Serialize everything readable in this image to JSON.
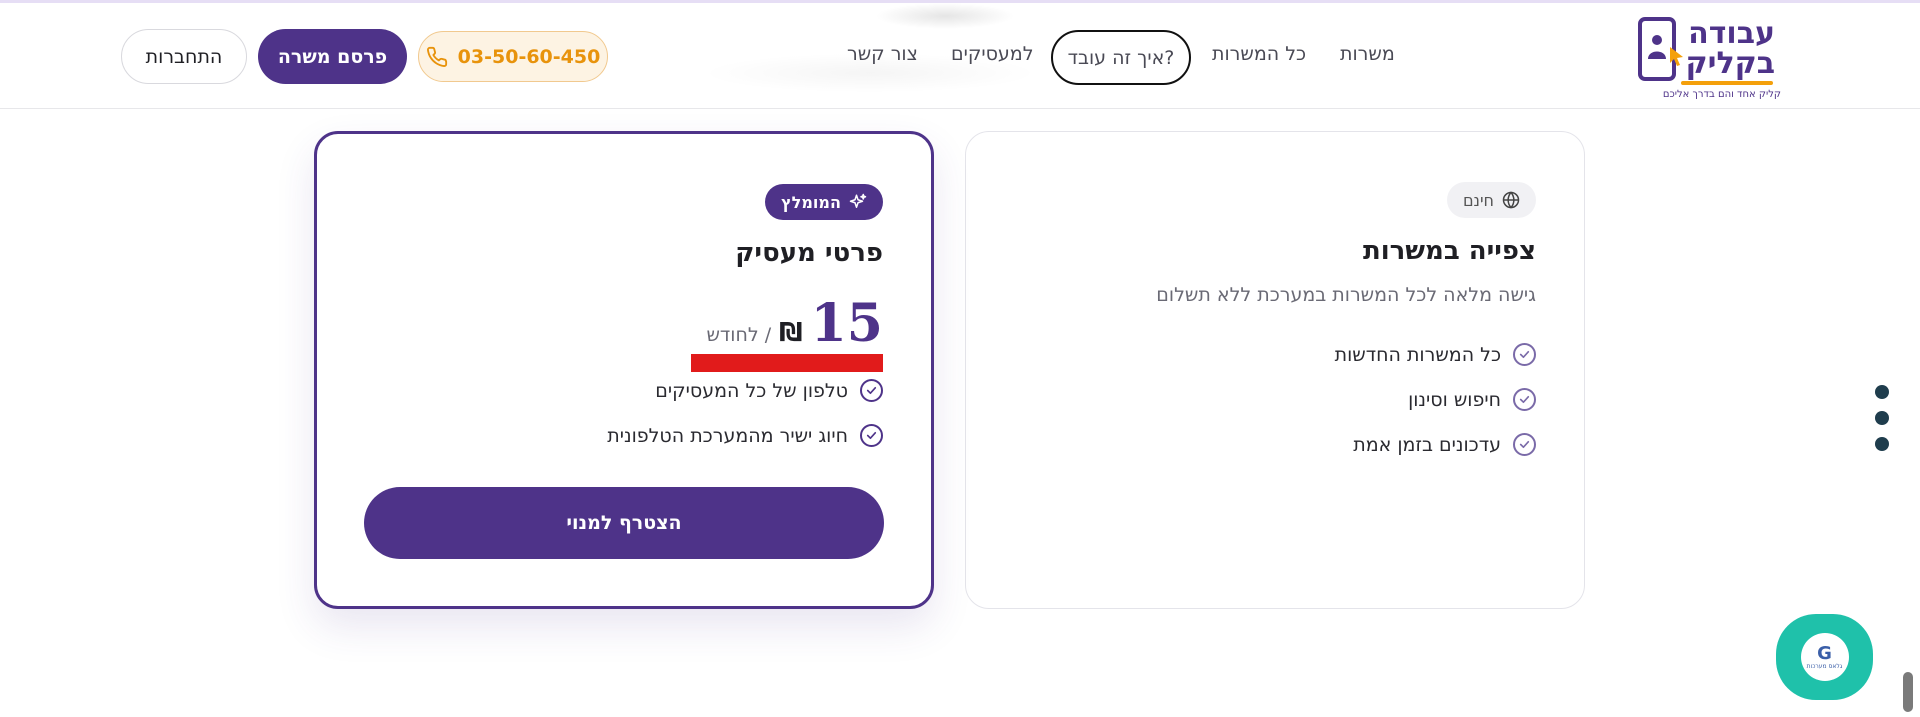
{
  "header": {
    "logo": {
      "title_line1": "עבודה",
      "title_line2": "בקליק",
      "tagline": "קליק אחד והם בדרך אליכם"
    },
    "nav": [
      {
        "label": "משרות"
      },
      {
        "label": "כל המשרות"
      },
      {
        "label": "איך זה עובד?"
      },
      {
        "label": "למעסיקים"
      },
      {
        "label": "צור קשר"
      }
    ],
    "phone": "03-50-60-450",
    "post_job_label": "פרסם משרה",
    "login_label": "התחברות"
  },
  "plans": {
    "free": {
      "badge": "חינם",
      "title": "צפייה במשרות",
      "subtitle": "גישה מלאה לכל המשרות במערכת ללא תשלום",
      "features": [
        "כל המשרות החדשות",
        "חיפוש וסינון",
        "עדכונים בזמן אמת"
      ]
    },
    "employer": {
      "badge": "המומלץ",
      "title": "פרטי מעסיק",
      "price": "15",
      "currency": "₪",
      "period": "/ לחודש",
      "features": [
        "טלפון של כל המעסיקים",
        "חיוג ישיר מהמערכת הטלפונית"
      ],
      "cta": "הצטרף למנוי"
    }
  },
  "chat": {
    "label": "גלאס מערכות",
    "letter": "G"
  },
  "colors": {
    "brand": "#4e3389",
    "accent": "#f4a00b",
    "chat": "#1fc1aa",
    "redaction": "#e11b1b"
  }
}
